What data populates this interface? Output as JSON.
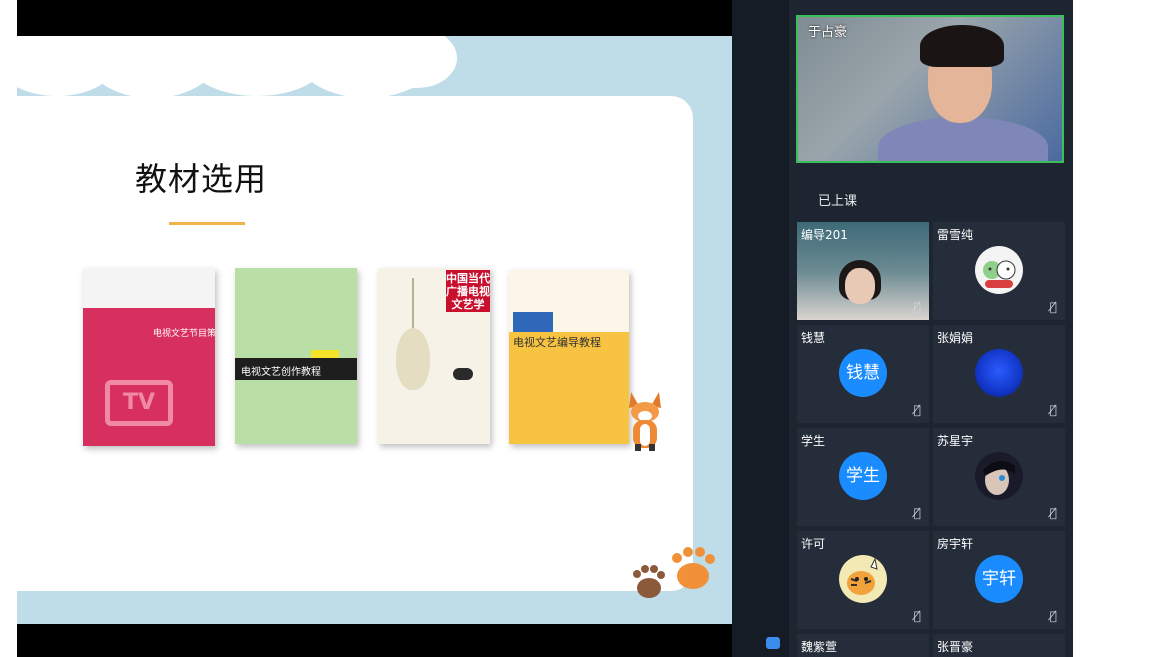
{
  "slide": {
    "title": "教材选用",
    "books": [
      {
        "title": "电视文艺节目策划"
      },
      {
        "title": "电视文艺创作教程"
      },
      {
        "title": "中国当代广播电视文艺学"
      },
      {
        "title": "电视文艺编导教程"
      }
    ],
    "tv_logo": "TV"
  },
  "presenter": {
    "name": "于占豪"
  },
  "section_label": "已上课",
  "participants": [
    {
      "name": "编导201",
      "avatar_text": "",
      "avatar_type": "video"
    },
    {
      "name": "雷雪纯",
      "avatar_text": "",
      "avatar_type": "image"
    },
    {
      "name": "钱慧",
      "avatar_text": "钱慧",
      "avatar_type": "text"
    },
    {
      "name": "张娟娟",
      "avatar_text": "",
      "avatar_type": "image"
    },
    {
      "name": "学生",
      "avatar_text": "学生",
      "avatar_type": "text"
    },
    {
      "name": "苏星宇",
      "avatar_text": "",
      "avatar_type": "image"
    },
    {
      "name": "许可",
      "avatar_text": "",
      "avatar_type": "image"
    },
    {
      "name": "房宇轩",
      "avatar_text": "宇轩",
      "avatar_type": "text"
    },
    {
      "name": "魏紫萱",
      "avatar_text": "",
      "avatar_type": "none"
    },
    {
      "name": "张晋豪",
      "avatar_text": "",
      "avatar_type": "none"
    }
  ],
  "icons": {
    "mic_muted": "mic-muted-icon",
    "chat": "chat-icon"
  },
  "colors": {
    "accent_blue": "#1a8cff",
    "active_border": "#3ac05a",
    "panel_bg": "#1d2530"
  }
}
